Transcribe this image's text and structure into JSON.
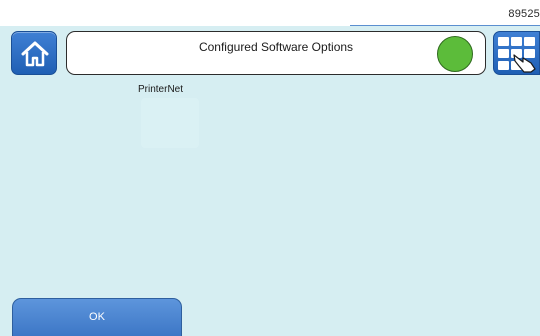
{
  "header": {
    "device_id": "89525",
    "title": "Configured Software Options"
  },
  "status": {
    "indicator_color": "#5cbc3a",
    "state": "green"
  },
  "options": [
    {
      "label": "PrinterNet"
    }
  ],
  "footer": {
    "ok_label": "OK"
  },
  "colors": {
    "background": "#d6eef2",
    "button_blue": "#2f6fc4",
    "title_bg": "#ffffff"
  },
  "icons": {
    "home": "home-icon",
    "menu": "grid-menu-icon"
  }
}
